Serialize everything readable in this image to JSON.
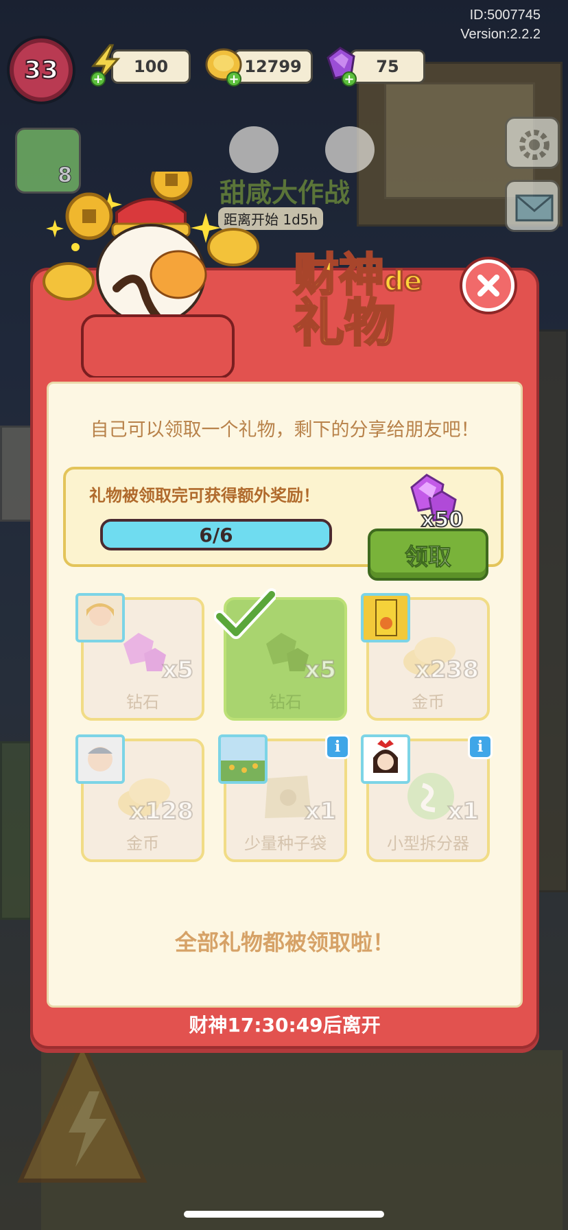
{
  "build": {
    "id": "ID:5007745",
    "version": "Version:2.2.2"
  },
  "hud": {
    "level": "33",
    "energy": "100",
    "coins": "12799",
    "gems": "75",
    "side_badge_count": "8"
  },
  "event": {
    "title": "甜咸大作战",
    "countdown": "距离开始 1d5h"
  },
  "modal": {
    "title_line1": "财神",
    "title_suffix": "de",
    "title_line2": "礼物",
    "intro": "自己可以领取一个礼物，剩下的分享给朋友吧！",
    "bonus_label": "礼物被领取完可获得额外奖励！",
    "progress_text": "6/6",
    "progress_fraction": 1.0,
    "bonus_reward_qty": "x50",
    "claim_label": "领取",
    "all_claimed": "全部礼物都被领取啦！",
    "timer": "财神17:30:49后离开"
  },
  "gifts": [
    {
      "qty": "x5",
      "name": "钻石",
      "icon": "gem-icon",
      "claimed_by_self": false,
      "info": false
    },
    {
      "qty": "x5",
      "name": "钻石",
      "icon": "gem-icon",
      "claimed_by_self": true,
      "info": false
    },
    {
      "qty": "x238",
      "name": "金币",
      "icon": "coin-icon",
      "claimed_by_self": false,
      "info": false
    },
    {
      "qty": "x128",
      "name": "金币",
      "icon": "coin-icon",
      "claimed_by_self": false,
      "info": false
    },
    {
      "qty": "x1",
      "name": "少量种子袋",
      "icon": "seed-bag-icon",
      "claimed_by_self": false,
      "info": true
    },
    {
      "qty": "x1",
      "name": "小型拆分器",
      "icon": "splitter-icon",
      "claimed_by_self": false,
      "info": true
    }
  ],
  "colors": {
    "modal_red": "#e2524f",
    "paper": "#fdf7e3",
    "claim_green": "#79b33a",
    "progress_cyan": "#6fdcf0",
    "title_gold": "#ffd43b"
  }
}
